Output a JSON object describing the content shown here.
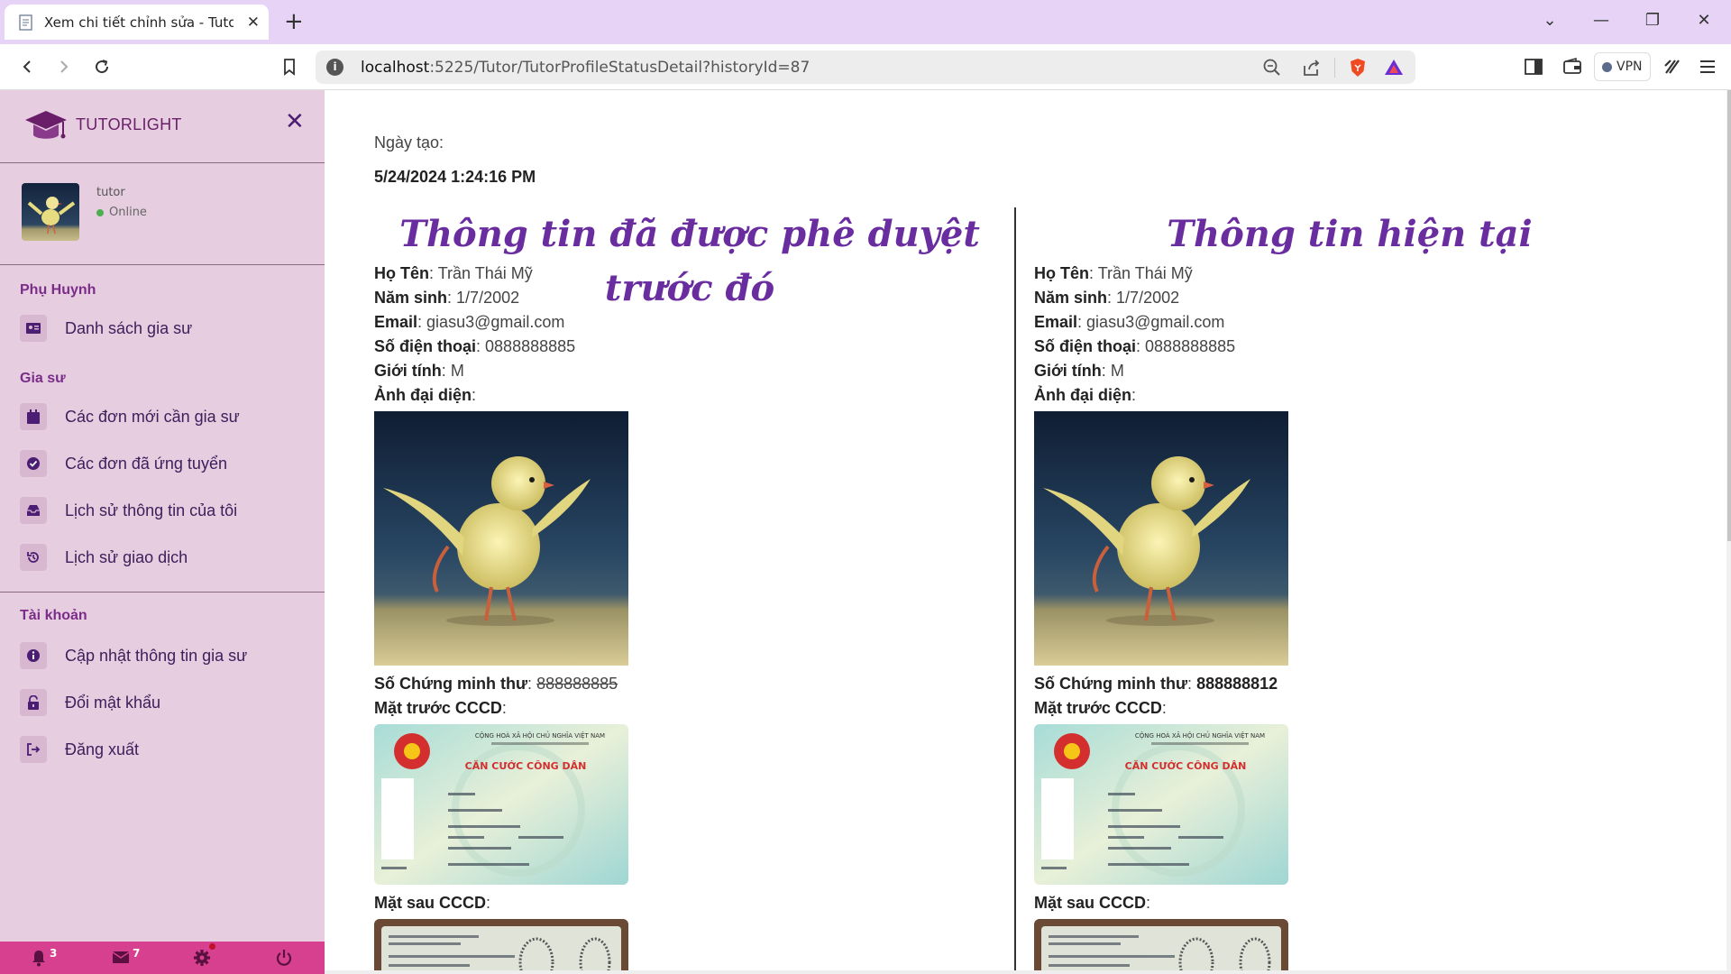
{
  "browser": {
    "tab_title": "Xem chi tiết chỉnh sửa - TutorLig",
    "url_host": "localhost",
    "url_path": ":5225/Tutor/TutorProfileStatusDetail?historyId=87",
    "vpn_label": "VPN"
  },
  "sidebar": {
    "brand": "TUTORLIGHT",
    "user": {
      "name": "tutor",
      "status": "Online"
    },
    "sections": [
      {
        "title": "Phụ Huynh",
        "items": [
          {
            "label": "Danh sách gia sư",
            "icon": "id-card-icon"
          }
        ]
      },
      {
        "title": "Gia sư",
        "items": [
          {
            "label": "Các đơn mới cần gia sư",
            "icon": "calendar-icon"
          },
          {
            "label": "Các đơn đã ứng tuyển",
            "icon": "check-circle-icon"
          },
          {
            "label": "Lịch sử thông tin của tôi",
            "icon": "inbox-icon"
          },
          {
            "label": "Lịch sử giao dịch",
            "icon": "history-icon"
          }
        ]
      },
      {
        "title": "Tài khoản",
        "items": [
          {
            "label": "Cập nhật thông tin gia sư",
            "icon": "info-icon"
          },
          {
            "label": "Đổi mật khẩu",
            "icon": "lock-icon"
          },
          {
            "label": "Đăng xuất",
            "icon": "logout-icon"
          }
        ]
      }
    ],
    "bottom_bar": {
      "notifications": "3",
      "messages": "7"
    }
  },
  "main": {
    "created_label": "Ngày tạo:",
    "created_value": "5/24/2024 1:24:16 PM",
    "labels": {
      "name": "Họ Tên",
      "birth_year": "Năm sinh",
      "email": "Email",
      "phone": "Số điện thoại",
      "gender": "Giới tính",
      "avatar": "Ảnh đại diện",
      "id_number": "Số Chứng minh thư",
      "id_front": "Mặt trước CCCD",
      "id_back": "Mặt sau CCCD"
    },
    "previous": {
      "title": "Thông tin đã được phê duyệt trước đó",
      "name": "Trần Thái Mỹ",
      "birth_year": "1/7/2002",
      "email": "giasu3@gmail.com",
      "phone": "0888888885",
      "gender": "M",
      "id_number": "888888885"
    },
    "current": {
      "title": "Thông tin hiện tại",
      "name": "Trần Thái Mỹ",
      "birth_year": "1/7/2002",
      "email": "giasu3@gmail.com",
      "phone": "0888888885",
      "gender": "M",
      "id_number": "888888812"
    },
    "card_text": {
      "country": "CỘNG HOÀ XÃ HỘI CHỦ NGHĨA VIỆT NAM",
      "title": "CĂN CƯỚC CÔNG DÂN"
    }
  }
}
